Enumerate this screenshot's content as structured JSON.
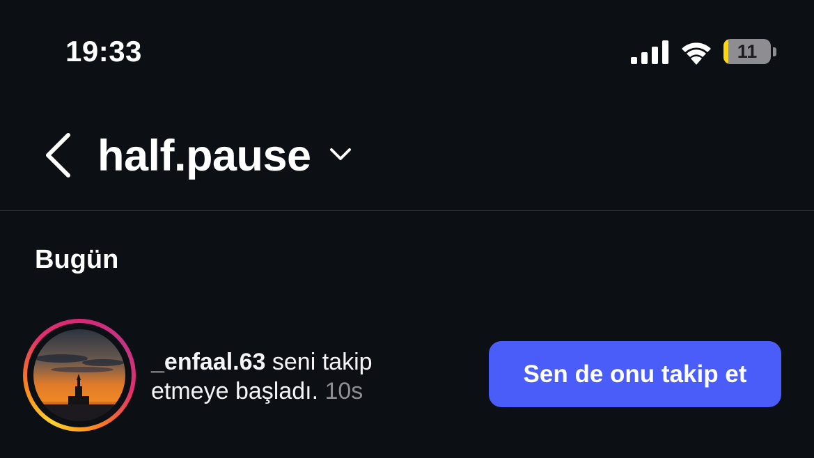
{
  "status_bar": {
    "time": "19:33",
    "battery_level": "11",
    "battery_fraction": 0.11,
    "icons": [
      "signal-icon",
      "wifi-icon",
      "battery-icon"
    ]
  },
  "header": {
    "title": "half.pause",
    "icons": [
      "back-icon",
      "chevron-down-icon"
    ]
  },
  "section": {
    "title": "Bugün"
  },
  "notification": {
    "username": "_enfaal.63",
    "message": " seni takip etmeye başladı. ",
    "time": "10s",
    "button_label": "Sen de onu takip et"
  },
  "colors": {
    "background": "#0c0f14",
    "accent": "#4a5df9",
    "battery_low": "#ffd60a",
    "muted_text": "#8e8e93"
  }
}
